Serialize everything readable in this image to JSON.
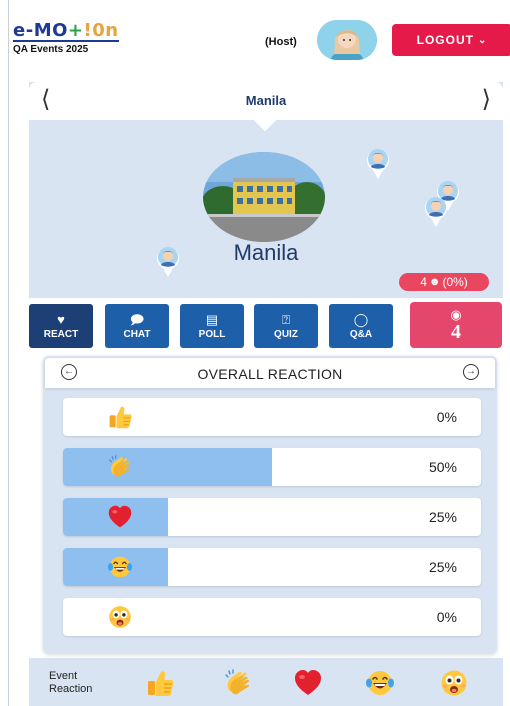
{
  "header": {
    "logo": {
      "part1": "e-",
      "part2": "MO",
      "part3": "+",
      "part4": "!0n",
      "subtitle": "QA Events 2025"
    },
    "host_label": "(Host)",
    "logout_label": "LOGOUT",
    "logout_color": "#e51a48"
  },
  "location": {
    "title": "Manila",
    "name": "Manila",
    "participants": "4",
    "participants_pct": "(0%)"
  },
  "actions": {
    "react": {
      "label": "REACT",
      "icon": "heart-chat-icon"
    },
    "chat": {
      "label": "CHAT",
      "icon": "chat-bubble-icon"
    },
    "poll": {
      "label": "POLL",
      "icon": "bar-chart-icon"
    },
    "quiz": {
      "label": "QUIZ",
      "icon": "question-icon"
    },
    "qa": {
      "label": "Q&A",
      "icon": "lightbulb-icon"
    },
    "views": {
      "count": "4",
      "icon": "eye-icon"
    }
  },
  "overall_reaction": {
    "title": "OVERALL REACTION",
    "rows": [
      {
        "emoji": "thumbs-up",
        "percent": "0%",
        "fill": 0
      },
      {
        "emoji": "clapping-hands",
        "percent": "50%",
        "fill": 0.5
      },
      {
        "emoji": "red-heart",
        "percent": "25%",
        "fill": 0.25
      },
      {
        "emoji": "laughing-face",
        "percent": "25%",
        "fill": 0.25
      },
      {
        "emoji": "surprised-face",
        "percent": "0%",
        "fill": 0
      }
    ]
  },
  "footer": {
    "label_line1": "Event",
    "label_line2": "Reaction",
    "emojis": [
      "thumbs-up",
      "clapping-hands",
      "red-heart",
      "laughing-face",
      "surprised-face"
    ]
  },
  "colors": {
    "accent_blue": "#1d5fa8",
    "active_blue": "#1c3f75",
    "pink": "#e5466b",
    "panel_bg": "#d9e4f2",
    "bar_fill": "#8ebfef"
  }
}
